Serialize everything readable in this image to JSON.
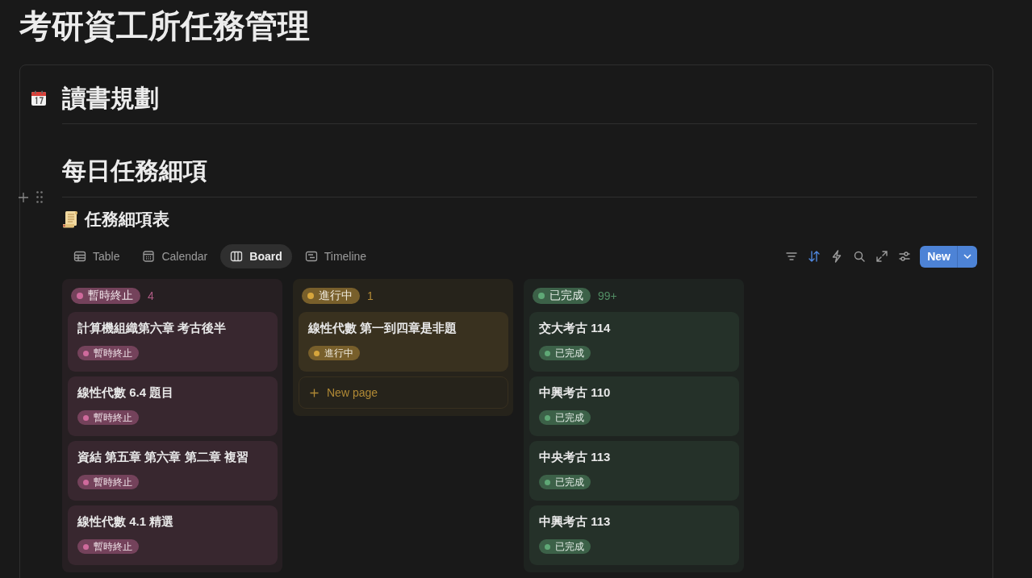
{
  "page_title": "考研資工所任務管理",
  "callout": {
    "heading": "讀書規劃",
    "section_heading": "每日任務細項",
    "database": {
      "title": "任務細項表",
      "views": [
        {
          "label": "Table",
          "selected": false
        },
        {
          "label": "Calendar",
          "selected": false
        },
        {
          "label": "Board",
          "selected": true
        },
        {
          "label": "Timeline",
          "selected": false
        }
      ],
      "toolbar": {
        "sort_applied": true
      },
      "new_button": {
        "label": "New"
      },
      "columns": [
        {
          "status": "暫時終止",
          "color": "#cf6a9c",
          "count": "4",
          "cards": [
            {
              "title": "計算機組織第六章 考古後半",
              "status": "暫時終止"
            },
            {
              "title": "線性代數 6.4 題目",
              "status": "暫時終止"
            },
            {
              "title": "資結 第五章 第六章 第二章 複習",
              "status": "暫時終止"
            },
            {
              "title": "線性代數 4.1 精選",
              "status": "暫時終止"
            }
          ]
        },
        {
          "status": "進行中",
          "color": "#d6a53c",
          "count": "1",
          "cards": [
            {
              "title": "線性代數 第一到四章是非題",
              "status": "進行中"
            }
          ],
          "new_page_label": "New page"
        },
        {
          "status": "已完成",
          "color": "#5fa876",
          "count": "99+",
          "cards": [
            {
              "title": "交大考古 114",
              "status": "已完成"
            },
            {
              "title": "中興考古 110",
              "status": "已完成"
            },
            {
              "title": "中央考古 113",
              "status": "已完成"
            },
            {
              "title": "中興考古 113",
              "status": "已完成"
            }
          ]
        }
      ]
    }
  }
}
